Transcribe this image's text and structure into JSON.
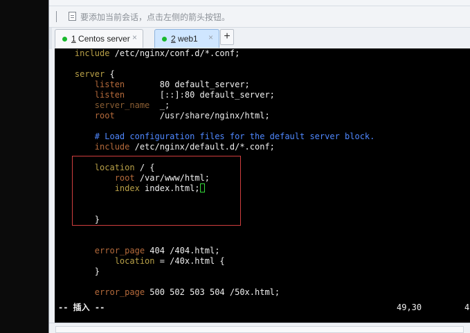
{
  "hint_bar": {
    "text": "要添加当前会话，点击左侧的箭头按钮。"
  },
  "tabs": [
    {
      "number": "1",
      "label": "Centos server",
      "active": false,
      "status_color": "#19b82d"
    },
    {
      "number": "2",
      "label": "web1",
      "active": true,
      "status_color": "#19b82d"
    }
  ],
  "tab_add_label": "+",
  "editor": {
    "lines": [
      {
        "indent": "    ",
        "parts": [
          [
            "kw",
            "include"
          ],
          [
            "txt",
            " /etc/nginx/conf.d/*.conf;"
          ]
        ]
      },
      {
        "indent": "",
        "parts": []
      },
      {
        "indent": "    ",
        "parts": [
          [
            "kw",
            "server"
          ],
          [
            "txt",
            " {"
          ]
        ]
      },
      {
        "indent": "        ",
        "parts": [
          [
            "prop",
            "listen"
          ],
          [
            "txt",
            "       80 default_server;"
          ]
        ]
      },
      {
        "indent": "        ",
        "parts": [
          [
            "prop",
            "listen"
          ],
          [
            "txt",
            "       [::]:80 default_server;"
          ]
        ]
      },
      {
        "indent": "        ",
        "parts": [
          [
            "prop2",
            "server_name"
          ],
          [
            "txt",
            "  _;"
          ]
        ]
      },
      {
        "indent": "        ",
        "parts": [
          [
            "prop",
            "root"
          ],
          [
            "txt",
            "         /usr/share/nginx/html;"
          ]
        ]
      },
      {
        "indent": "",
        "parts": []
      },
      {
        "indent": "        ",
        "parts": [
          [
            "cmt",
            "# Load configuration files for the default server block."
          ]
        ]
      },
      {
        "indent": "        ",
        "parts": [
          [
            "prop",
            "include"
          ],
          [
            "txt",
            " /etc/nginx/default.d/*.conf;"
          ]
        ]
      },
      {
        "indent": "",
        "parts": []
      },
      {
        "indent": "        ",
        "parts": [
          [
            "kw",
            "location"
          ],
          [
            "txt",
            " / {"
          ]
        ]
      },
      {
        "indent": "            ",
        "parts": [
          [
            "prop",
            "root"
          ],
          [
            "txt",
            " /var/www/html;"
          ]
        ]
      },
      {
        "indent": "            ",
        "parts": [
          [
            "kw",
            "index"
          ],
          [
            "txt",
            " index.html;"
          ]
        ],
        "cursor": true
      },
      {
        "indent": "",
        "parts": []
      },
      {
        "indent": "",
        "parts": []
      },
      {
        "indent": "        ",
        "parts": [
          [
            "txt",
            "}"
          ]
        ]
      },
      {
        "indent": "",
        "parts": []
      },
      {
        "indent": "",
        "parts": []
      },
      {
        "indent": "        ",
        "parts": [
          [
            "prop",
            "error_page"
          ],
          [
            "txt",
            " 404 /404.html;"
          ]
        ]
      },
      {
        "indent": "            ",
        "parts": [
          [
            "kw",
            "location"
          ],
          [
            "txt",
            " = /40x.html {"
          ]
        ]
      },
      {
        "indent": "        ",
        "parts": [
          [
            "txt",
            "}"
          ]
        ]
      },
      {
        "indent": "",
        "parts": []
      },
      {
        "indent": "        ",
        "parts": [
          [
            "prop",
            "error_page"
          ],
          [
            "txt",
            " 500 502 503 504 /50x.html;"
          ]
        ]
      }
    ],
    "status_mode": "-- 插入 --",
    "status_position": "49,30",
    "status_percent": "4"
  }
}
